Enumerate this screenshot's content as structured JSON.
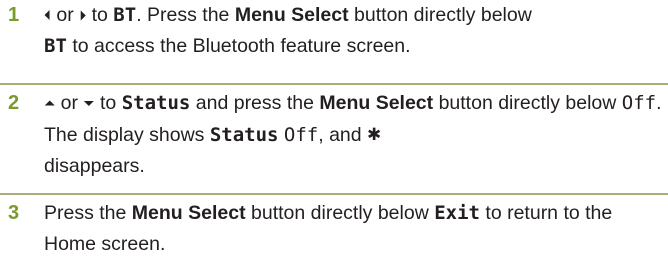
{
  "steps": [
    {
      "number": "1",
      "left_glyph": "⏴",
      "or": "or",
      "right_glyph": "⏵",
      "to": "to",
      "target": "BT",
      "p1": ". Press the",
      "button": "Menu Select",
      "p2": "button directly below",
      "below": "BT",
      "p3": "to access the Bluetooth feature screen."
    },
    {
      "number": "2",
      "up_glyph": "⏶",
      "or": "or",
      "down_glyph": "⏷",
      "to": "to",
      "target": "Status",
      "p1": "and press the",
      "button": "Menu Select",
      "p2": "button directly below",
      "below": "Off",
      "p3": ". The display shows",
      "display_status": "Status",
      "display_off": "Off",
      "p4": ", and",
      "bt_icon": "✱",
      "p5": "disappears."
    },
    {
      "number": "3",
      "p1": "Press the",
      "button": "Menu Select",
      "p2": "button directly below",
      "below": "Exit",
      "p3": "to return to the Home screen."
    }
  ],
  "colors": {
    "step_number": "#7a9a2a",
    "divider": "#a8ad7a",
    "text": "#231f20"
  }
}
